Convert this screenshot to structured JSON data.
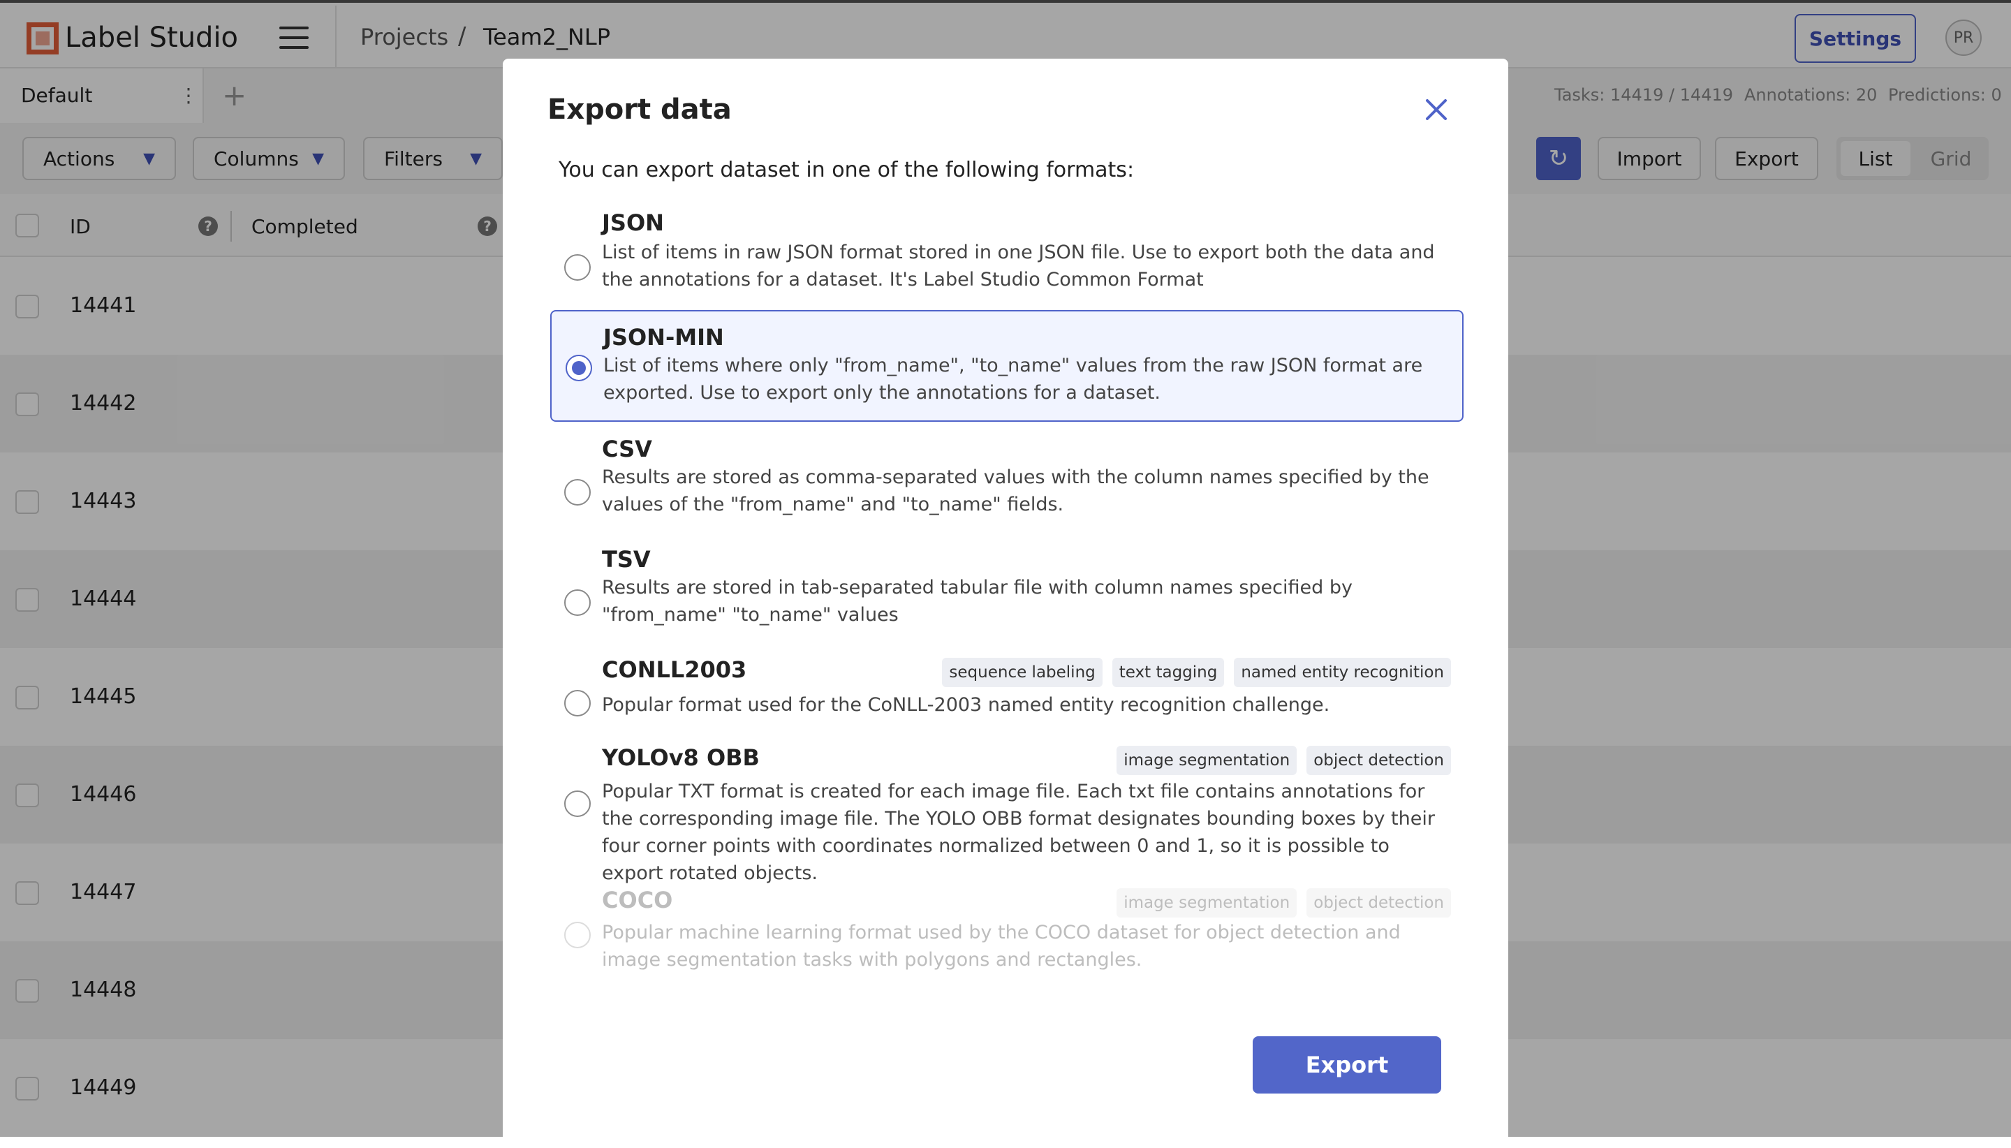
{
  "app": {
    "brand": "Label Studio"
  },
  "breadcrumb": {
    "projects": "Projects",
    "separator": "/",
    "current": "Team2_NLP"
  },
  "header": {
    "settings_label": "Settings",
    "avatar_initials": "PR"
  },
  "tabs": {
    "default_label": "Default",
    "menu_glyph": "⋮",
    "add_glyph": "+"
  },
  "stats": {
    "tasks": "Tasks: 14419 / 14419",
    "annotations": "Annotations: 20",
    "predictions": "Predictions: 0"
  },
  "toolbar": {
    "actions": "Actions",
    "columns": "Columns",
    "filters": "Filters",
    "import": "Import",
    "export": "Export",
    "view_list": "List",
    "view_grid": "Grid"
  },
  "table": {
    "columns": [
      "ID",
      "Completed"
    ],
    "help_glyph": "?",
    "rows": [
      "14441",
      "14442",
      "14443",
      "14444",
      "14445",
      "14446",
      "14447",
      "14448",
      "14449"
    ]
  },
  "modal": {
    "title": "Export data",
    "intro": "You can export dataset in one of the following formats:",
    "export_button": "Export",
    "selected_format": "JSON-MIN",
    "formats": [
      {
        "name": "JSON",
        "description": "List of items in raw JSON format stored in one JSON file. Use to export both the data and the annotations for a dataset. It's Label Studio Common Format",
        "tags": []
      },
      {
        "name": "JSON-MIN",
        "description": "List of items where only \"from_name\", \"to_name\" values from the raw JSON format are exported. Use to export only the annotations for a dataset.",
        "tags": []
      },
      {
        "name": "CSV",
        "description": "Results are stored as comma-separated values with the column names specified by the values of the \"from_name\" and \"to_name\" fields.",
        "tags": []
      },
      {
        "name": "TSV",
        "description": "Results are stored in tab-separated tabular file with column names specified by \"from_name\" \"to_name\" values",
        "tags": []
      },
      {
        "name": "CONLL2003",
        "description": "Popular format used for the CoNLL-2003 named entity recognition challenge.",
        "tags": [
          "sequence labeling",
          "text tagging",
          "named entity recognition"
        ]
      },
      {
        "name": "YOLOv8 OBB",
        "description": "Popular TXT format is created for each image file. Each txt file contains annotations for the corresponding image file. The YOLO OBB format designates bounding boxes by their four corner points with coordinates normalized between 0 and 1, so it is possible to export rotated objects.",
        "tags": [
          "image segmentation",
          "object detection"
        ]
      },
      {
        "name": "COCO",
        "description": "Popular machine learning format used by the COCO dataset for object detection and image segmentation tasks with polygons and rectangles.",
        "tags": [
          "image segmentation",
          "object detection"
        ],
        "disabled": true
      }
    ]
  },
  "colors": {
    "accent": "#4f63c9",
    "brand_orange": "#e35f3a"
  }
}
